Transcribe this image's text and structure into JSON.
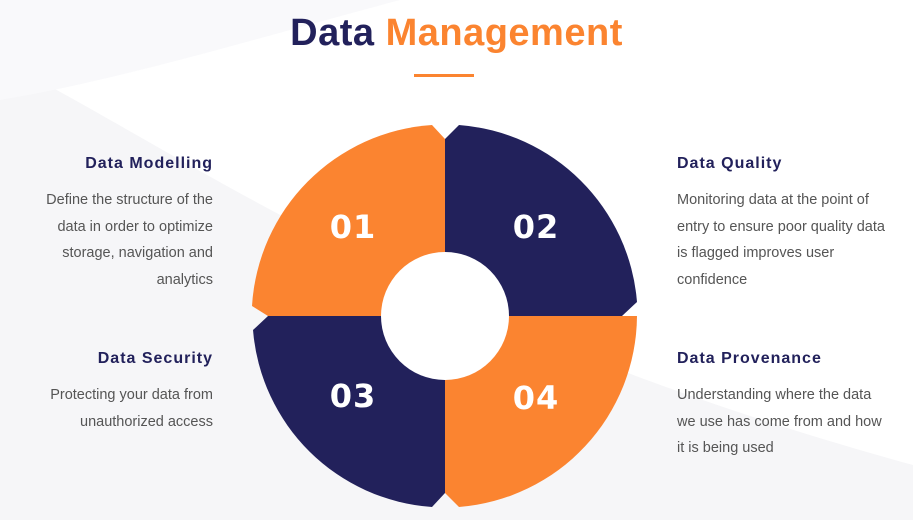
{
  "title": {
    "part1": "Data",
    "part2": "Management"
  },
  "colors": {
    "navy": "#22215b",
    "orange": "#fb8430",
    "text": "#555555"
  },
  "segments": [
    {
      "number": "01",
      "heading": "Data Modelling",
      "description": "Define the structure of the data in order to optimize storage, navigation and analytics",
      "color": "orange"
    },
    {
      "number": "02",
      "heading": "Data Quality",
      "description": "Monitoring data at the point of entry to ensure poor quality data is flagged improves user confidence",
      "color": "navy"
    },
    {
      "number": "03",
      "heading": "Data Security",
      "description": "Protecting your data from unauthorized access",
      "color": "navy"
    },
    {
      "number": "04",
      "heading": "Data Provenance",
      "description": "Understanding where the data we use has come from and how it is being used",
      "color": "orange"
    }
  ]
}
